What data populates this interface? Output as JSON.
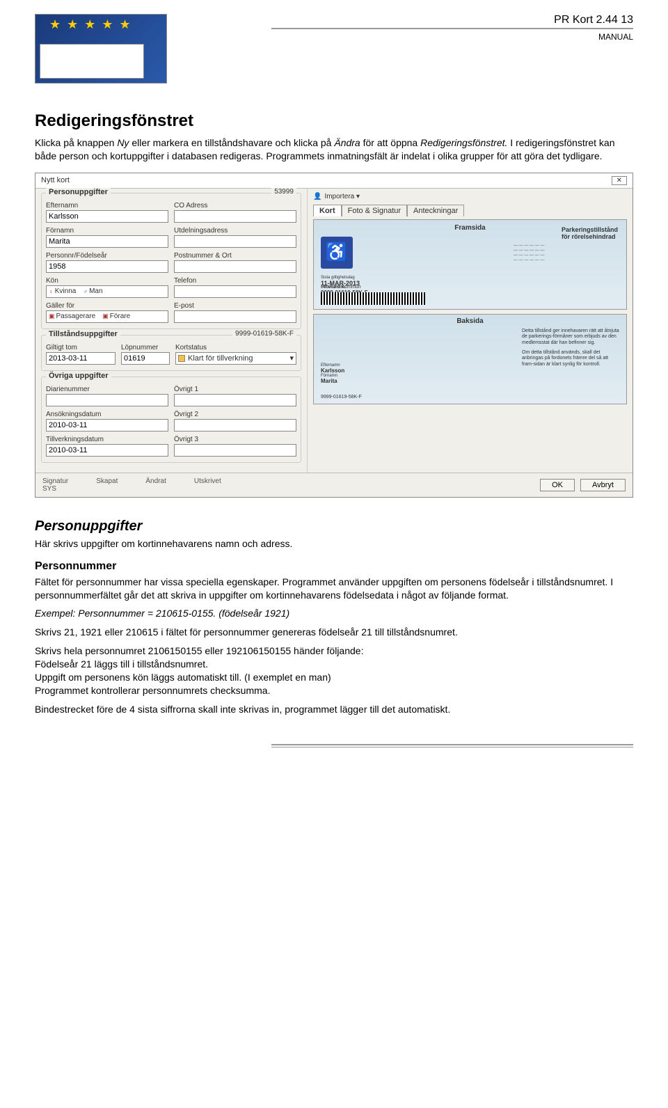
{
  "header": {
    "title_line": "PR Kort  2.44   13",
    "subtitle": "MANUAL"
  },
  "section1": {
    "heading": "Redigeringsfönstret",
    "p1a": "Klicka på knappen ",
    "p1b_em": "Ny",
    "p1c": " eller markera en tillståndshavare och klicka på ",
    "p1d_em": "Ändra",
    "p1e": " för att öppna ",
    "p1f_em": "Redigeringsfönstret.",
    "p1g": " I redigeringsfönstret kan både person och kortuppgifter i databasen redigeras. Programmets inmatningsfält är indelat i olika grupper för att göra det tydligare."
  },
  "window": {
    "title": "Nytt kort",
    "close": "✕",
    "import": "Importera  ▾",
    "tabs": {
      "kort": "Kort",
      "foto": "Foto & Signatur",
      "ant": "Anteckningar"
    },
    "grpPerson": {
      "legend": "Personuppgifter",
      "legr": "53999",
      "efternamn_l": "Efternamn",
      "efternamn_v": "Karlsson",
      "co_l": "CO Adress",
      "co_v": "",
      "fornamn_l": "Förnamn",
      "fornamn_v": "Marita",
      "utd_l": "Utdelningsadress",
      "utd_v": "",
      "pnr_l": "Personnr/Födelseår",
      "pnr_v": "1958",
      "port_l": "Postnummer & Ort",
      "port_v": "",
      "kon_l": "Kön",
      "kon_k": "Kvinna",
      "kon_m": "Man",
      "tel_l": "Telefon",
      "tel_v": "",
      "galler_l": "Gäller för",
      "galler_p": "Passagerare",
      "galler_f": "Förare",
      "epost_l": "E-post",
      "epost_v": ""
    },
    "grpTill": {
      "legend": "Tillståndsuppgifter",
      "legr": "9999-01619-58K-F",
      "gt_l": "Giltigt tom",
      "gt_v": "2013-03-11",
      "lop_l": "Löpnummer",
      "lop_v": "01619",
      "ks_l": "Kortstatus",
      "ks_v": "Klart för tillverkning"
    },
    "grpOvr": {
      "legend": "Övriga uppgifter",
      "dia_l": "Diarienummer",
      "dia_v": "",
      "o1_l": "Övrigt 1",
      "o1_v": "",
      "ans_l": "Ansökningsdatum",
      "ans_v": "2010-03-11",
      "o2_l": "Övrigt 2",
      "o2_v": "",
      "tvk_l": "Tillverkningsdatum",
      "tvk_v": "2010-03-11",
      "o3_l": "Övrigt 3",
      "o3_v": ""
    },
    "footer": {
      "sig_l": "Signatur",
      "sig_v": "SYS",
      "sk_l": "Skapat",
      "an_l": "Ändrat",
      "ut_l": "Utskrivet",
      "ok": "OK",
      "cancel": "Avbryt"
    },
    "front": {
      "hdr": "Framsida",
      "tt1": "Parkeringstillstånd",
      "tt2": "för rörelsehindrad",
      "date_l": "Sista giltighetsdag",
      "date_v": "11-MAR-2013",
      "ser_l": "Serienummer",
      "ser_v": "9999-01619-58K-F",
      "issuer": "Provlund Kommun"
    },
    "back": {
      "hdr": "Baksida",
      "txt1": "Detta tillstånd ger innehavaren rätt att åtnjuta de parkerings-förmåner som erbjuds av den medlemsstat där han befinner sig.",
      "txt2": "Om detta tillstånd används, skall det anbringas på fordonets främre del så att fram-sidan är klart synlig för kontroll.",
      "efternamn_l": "Efternamn",
      "efternamn_v": "Karlsson",
      "fornamn_l": "Förnamn",
      "fornamn_v": "Marita",
      "ser": "9999-01619-58K-F"
    }
  },
  "section2": {
    "h": "Personuppgifter",
    "p": "Här skrivs uppgifter om kortinnehavarens namn och adress."
  },
  "section3": {
    "h": "Personnummer",
    "p1": "Fältet för personnummer har vissa speciella egenskaper. Programmet använder uppgiften om personens födelseår i tillståndsnumret. I personnummerfältet går det att skriva in uppgifter om kortinnehavarens födelsedata i något av följande format.",
    "ex_em": "Exempel:  Personnummer = 210615-0155. (födelseår 1921)",
    "p2": "Skrivs 21, 1921 eller 210615 i fältet för personnummer genereras födelseår 21 till tillståndsnumret.",
    "p3": "Skrivs hela personnumret 2106150155 eller 192106150155 händer följande:",
    "p4": "Födelseår 21 läggs till i tillståndsnumret.",
    "p5": "Uppgift om personens kön läggs automatiskt till. (I exemplet en man)",
    "p6": "Programmet kontrollerar personnumrets checksumma.",
    "p7": "Bindestrecket före de 4 sista siffrorna skall inte skrivas in, programmet lägger till det automatiskt."
  }
}
